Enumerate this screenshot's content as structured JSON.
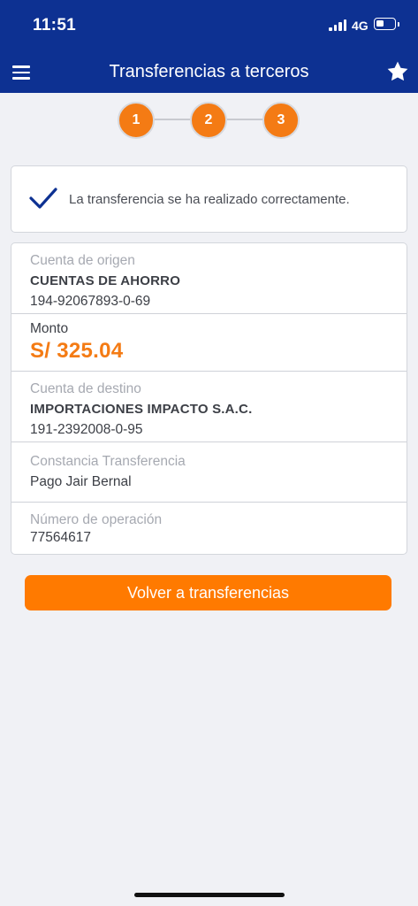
{
  "status_bar": {
    "time": "11:51",
    "network": "4G"
  },
  "header": {
    "title": "Transferencias a terceros"
  },
  "stepper": {
    "steps": [
      "1",
      "2",
      "3"
    ]
  },
  "success": {
    "message": "La transferencia se ha realizado correctamente."
  },
  "details": {
    "origin": {
      "label": "Cuenta de origen",
      "name": "CUENTAS DE AHORRO",
      "number": "194-92067893-0-69"
    },
    "amount": {
      "label": "Monto",
      "value": "S/ 325.04"
    },
    "destination": {
      "label": "Cuenta de destino",
      "name": "IMPORTACIONES IMPACTO S.A.C.",
      "number": "191-2392008-0-95"
    },
    "receipt": {
      "label": "Constancia Transferencia",
      "value": "Pago Jair Bernal"
    },
    "operation": {
      "label": "Número de operación",
      "value": "77564617"
    }
  },
  "actions": {
    "back_label": "Volver a transferencias"
  },
  "colors": {
    "brand_blue": "#0d3192",
    "accent_orange": "#f47b14",
    "button_orange": "#ff7a00"
  },
  "icons": {
    "menu": "hamburger-menu-icon",
    "favorite": "star-icon",
    "success": "checkmark-icon"
  }
}
